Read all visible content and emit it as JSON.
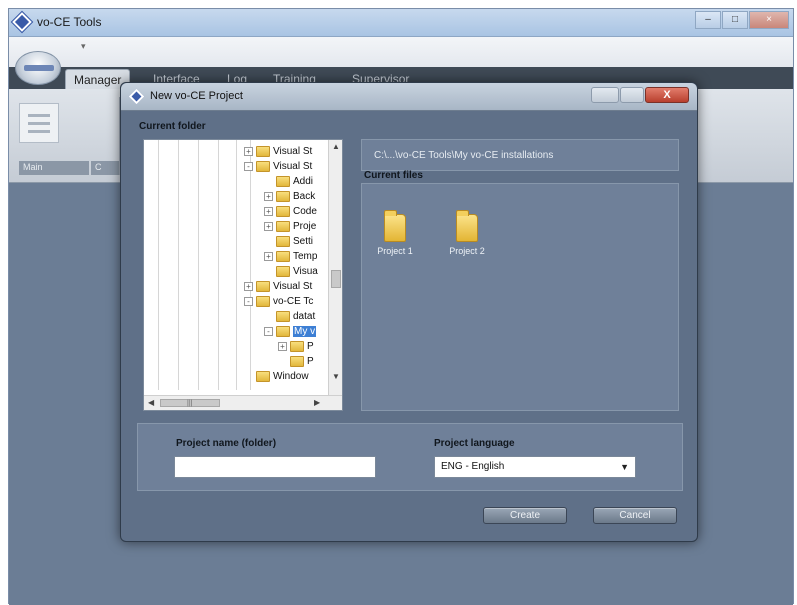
{
  "app": {
    "title": "vo-CE Tools",
    "tabs": [
      "Manager",
      "Interface",
      "Log",
      "Training",
      "Supervisor"
    ],
    "ribbon_groups": [
      "Main",
      "C"
    ]
  },
  "dialog": {
    "title": "New vo-CE Project",
    "close_label": "X",
    "current_folder_label": "Current folder",
    "tree": [
      {
        "label": "Visual St",
        "expander": "+",
        "level": 0
      },
      {
        "label": "Visual St",
        "expander": "-",
        "level": 0
      },
      {
        "label": "Addi",
        "expander": "",
        "level": 1
      },
      {
        "label": "Back",
        "expander": "+",
        "level": 1
      },
      {
        "label": "Code",
        "expander": "+",
        "level": 1
      },
      {
        "label": "Proje",
        "expander": "+",
        "level": 1
      },
      {
        "label": "Setti",
        "expander": "",
        "level": 1
      },
      {
        "label": "Temp",
        "expander": "+",
        "level": 1
      },
      {
        "label": "Visua",
        "expander": "",
        "level": 1
      },
      {
        "label": "Visual St",
        "expander": "+",
        "level": 0
      },
      {
        "label": "vo-CE Tc",
        "expander": "-",
        "level": 0
      },
      {
        "label": "datat",
        "expander": "",
        "level": 1
      },
      {
        "label": "My v",
        "expander": "-",
        "level": 1,
        "selected": true
      },
      {
        "label": "P",
        "expander": "+",
        "level": 2
      },
      {
        "label": "P",
        "expander": "",
        "level": 2
      },
      {
        "label": "Window",
        "expander": "",
        "level": 0
      }
    ],
    "current_path": "C:\\...\\vo-CE Tools\\My vo-CE installations",
    "current_files_label": "Current files",
    "files": [
      "Project 1",
      "Project 2"
    ],
    "project_name_label": "Project name (folder)",
    "project_name_value": "",
    "project_language_label": "Project language",
    "project_language_value": "ENG - English",
    "create_label": "Create",
    "cancel_label": "Cancel"
  }
}
